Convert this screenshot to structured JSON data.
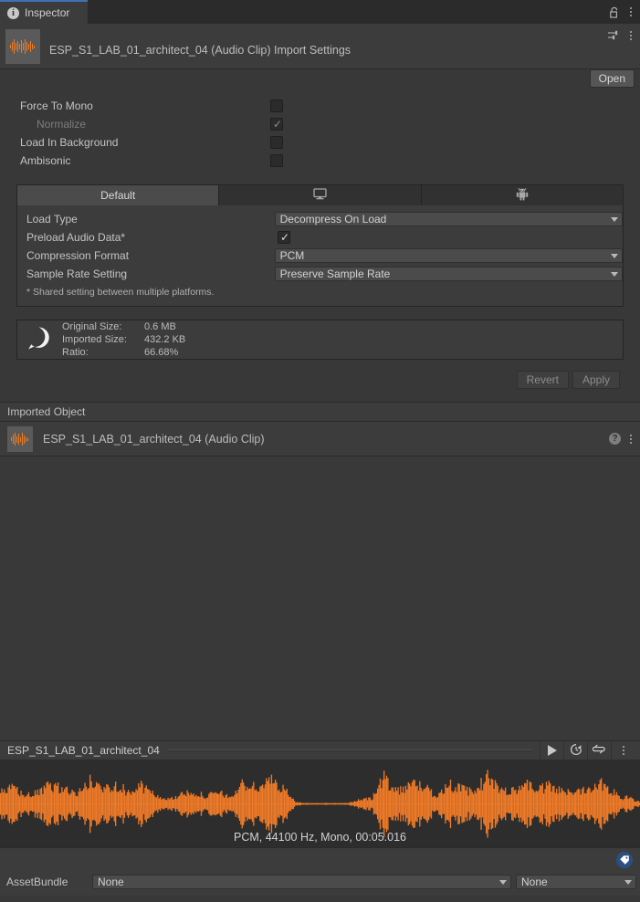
{
  "window": {
    "tab_label": "Inspector",
    "tab_icon": "info-icon",
    "lock_icon": "lock-open-icon",
    "menu_icon": "kebab-menu-icon"
  },
  "header": {
    "title": "ESP_S1_LAB_01_architect_04 (Audio Clip) Import Settings",
    "thumbnail_icon": "audio-waveform-thumbnail",
    "preset_icon": "preset-settings-icon",
    "menu_icon": "kebab-menu-icon",
    "open_button": "Open"
  },
  "properties": [
    {
      "label": "Force To Mono",
      "checked": false,
      "disabled": false
    },
    {
      "label": "Normalize",
      "checked": true,
      "disabled": true
    },
    {
      "label": "Load In Background",
      "checked": false,
      "disabled": false
    },
    {
      "label": "Ambisonic",
      "checked": false,
      "disabled": false
    }
  ],
  "platform": {
    "tabs": [
      {
        "label": "Default",
        "icon": "",
        "active": true
      },
      {
        "label": "",
        "icon": "standalone-desktop-icon",
        "active": false
      },
      {
        "label": "",
        "icon": "android-robot-icon",
        "active": false
      }
    ],
    "rows": [
      {
        "label": "Load Type",
        "type": "dropdown",
        "value": "Decompress On Load"
      },
      {
        "label": "Preload Audio Data*",
        "type": "checkbox",
        "checked": true
      },
      {
        "label": "Compression Format",
        "type": "dropdown",
        "value": "PCM"
      },
      {
        "label": "Sample Rate Setting",
        "type": "dropdown",
        "value": "Preserve Sample Rate"
      }
    ],
    "note": "* Shared setting between multiple platforms."
  },
  "info_box": {
    "icon": "info-bubble-icon",
    "rows": [
      {
        "label": "Original Size:",
        "value": "0.6 MB"
      },
      {
        "label": "Imported Size:",
        "value": "432.2 KB"
      },
      {
        "label": "Ratio:",
        "value": "66.68%"
      }
    ]
  },
  "actions": {
    "revert": "Revert",
    "apply": "Apply",
    "disabled": true
  },
  "imported_object": {
    "section_title": "Imported Object",
    "name": "ESP_S1_LAB_01_architect_04 (Audio Clip)",
    "thumbnail_icon": "audio-waveform-thumbnail",
    "help_icon": "help-icon",
    "menu_icon": "kebab-menu-icon"
  },
  "audio_preview": {
    "clip_name": "ESP_S1_LAB_01_architect_04",
    "play_icon": "play-icon",
    "loop_time_icon": "replay-clock-icon",
    "repeat_icon": "loop-repeat-icon",
    "menu_icon": "kebab-menu-icon",
    "caption": "PCM, 44100 Hz, Mono, 00:05.016",
    "waveform_color": "#F07B28",
    "background_color": "#2d2d2d"
  },
  "asset_bundle": {
    "label": "AssetBundle",
    "name_value": "None",
    "variant_value": "None",
    "tag_icon": "asset-label-tag-icon",
    "tag_color": "#2b4f82"
  },
  "colors": {
    "panel": "#3c3c3c",
    "background": "#383838",
    "accent": "#3f6fb5",
    "text": "#c4c4c4"
  }
}
